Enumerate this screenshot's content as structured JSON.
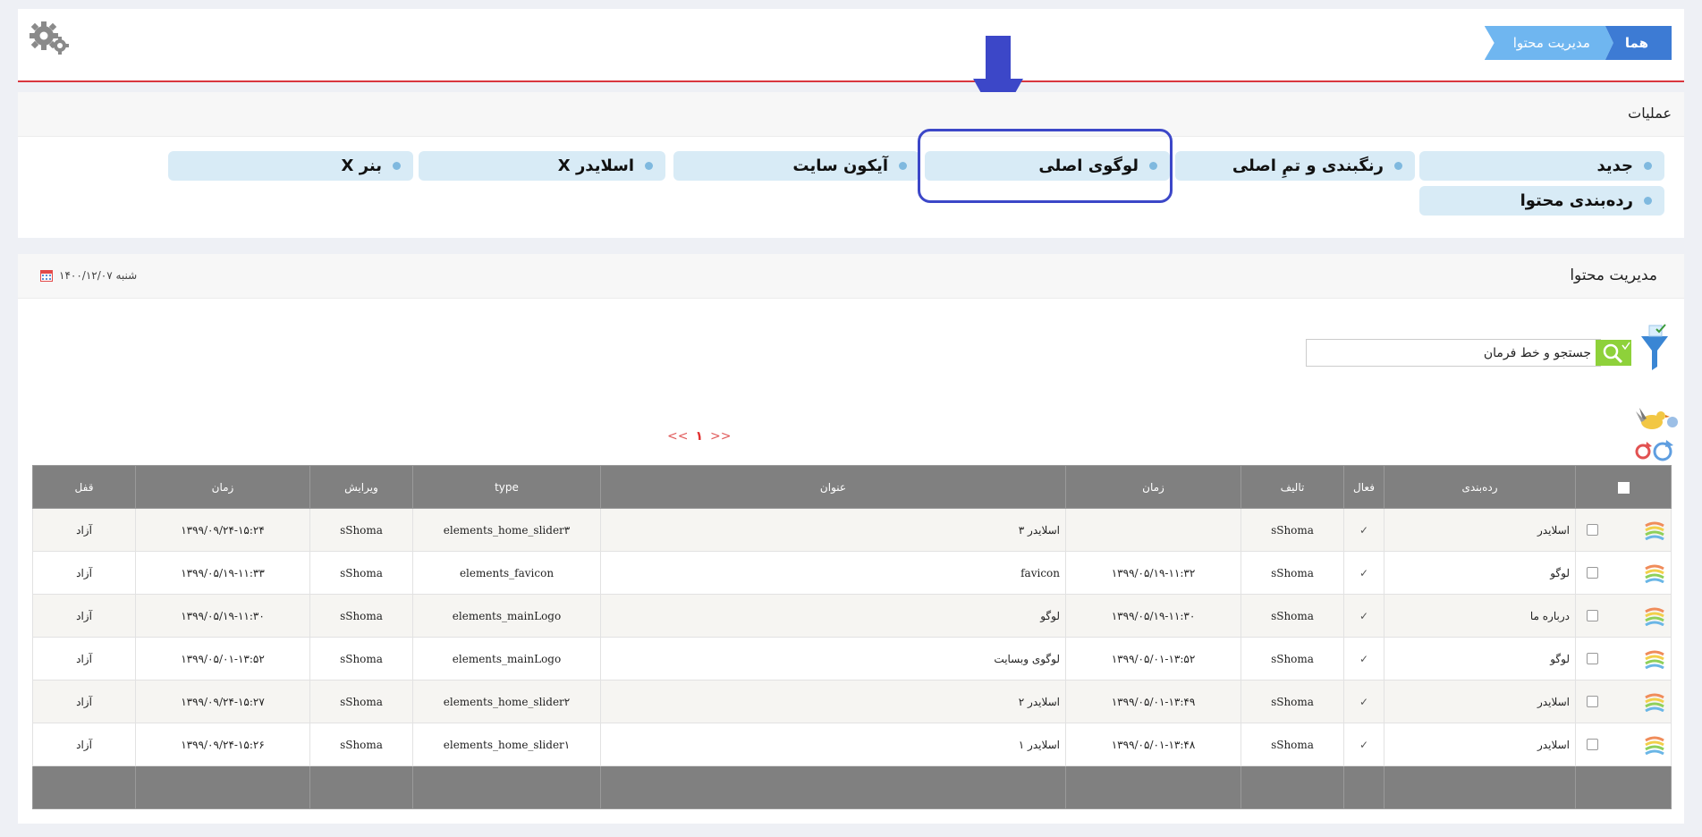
{
  "breadcrumb": {
    "home": "هما",
    "current": "مدیریت محتوا"
  },
  "operations": {
    "title": "عملیات",
    "buttons": [
      {
        "label": "جدید"
      },
      {
        "label": "رنگبندی و تمِ اصلی"
      },
      {
        "label": "لوگوی اصلی"
      },
      {
        "label": "آیکون سایت"
      },
      {
        "label": "اسلایدر X"
      },
      {
        "label": "بنر X"
      },
      {
        "label": "ردەبندی محتوا"
      }
    ]
  },
  "content": {
    "title": "مدیریت محتوا",
    "date": "شنبه ۱۴۰۰/۱۲/۰۷",
    "search_value": "جستجو و خط فرمان"
  },
  "pager": {
    "prev": "<<",
    "current": "۱",
    "next": ">>"
  },
  "table": {
    "headers": {
      "category": "ردەبندی",
      "active": "فعال",
      "author": "تالیف",
      "time": "زمان",
      "title": "عنوان",
      "type": "type",
      "edit": "ویرایش",
      "time2": "زمان",
      "lock": "قفل"
    },
    "rows": [
      {
        "category": "اسلایدر",
        "active": "✓",
        "author": "sShoma",
        "time": "",
        "title": "اسلایدر ۳",
        "type": "elements_home_slider۳",
        "edit": "sShoma",
        "time2": "۱۳۹۹/۰۹/۲۴-۱۵:۲۴",
        "lock": "آزاد"
      },
      {
        "category": "لوگو",
        "active": "✓",
        "author": "sShoma",
        "time": "۱۳۹۹/۰۵/۱۹-۱۱:۳۲",
        "title": "favicon",
        "type": "elements_favicon",
        "edit": "sShoma",
        "time2": "۱۳۹۹/۰۵/۱۹-۱۱:۳۳",
        "lock": "آزاد"
      },
      {
        "category": "درباره ما",
        "active": "✓",
        "author": "sShoma",
        "time": "۱۳۹۹/۰۵/۱۹-۱۱:۳۰",
        "title": "لوگو",
        "type": "elements_mainLogo",
        "edit": "sShoma",
        "time2": "۱۳۹۹/۰۵/۱۹-۱۱:۳۰",
        "lock": "آزاد"
      },
      {
        "category": "لوگو",
        "active": "✓",
        "author": "sShoma",
        "time": "۱۳۹۹/۰۵/۰۱-۱۳:۵۲",
        "title": "لوگوی وبسایت",
        "type": "elements_mainLogo",
        "edit": "sShoma",
        "time2": "۱۳۹۹/۰۵/۰۱-۱۳:۵۲",
        "lock": "آزاد"
      },
      {
        "category": "اسلایدر",
        "active": "✓",
        "author": "sShoma",
        "time": "۱۳۹۹/۰۵/۰۱-۱۳:۴۹",
        "title": "اسلایدر ۲",
        "type": "elements_home_slider۲",
        "edit": "sShoma",
        "time2": "۱۳۹۹/۰۹/۲۴-۱۵:۲۷",
        "lock": "آزاد"
      },
      {
        "category": "اسلایدر",
        "active": "✓",
        "author": "sShoma",
        "time": "۱۳۹۹/۰۵/۰۱-۱۳:۴۸",
        "title": "اسلایدر ۱",
        "type": "elements_home_slider۱",
        "edit": "sShoma",
        "time2": "۱۳۹۹/۰۹/۲۴-۱۵:۲۶",
        "lock": "آزاد"
      }
    ]
  },
  "colors": {
    "accent": "#3d7bd4",
    "header_line": "#d9363e",
    "highlight": "#3c47c8",
    "table_header": "#808080",
    "search_button": "#8ed13a"
  }
}
